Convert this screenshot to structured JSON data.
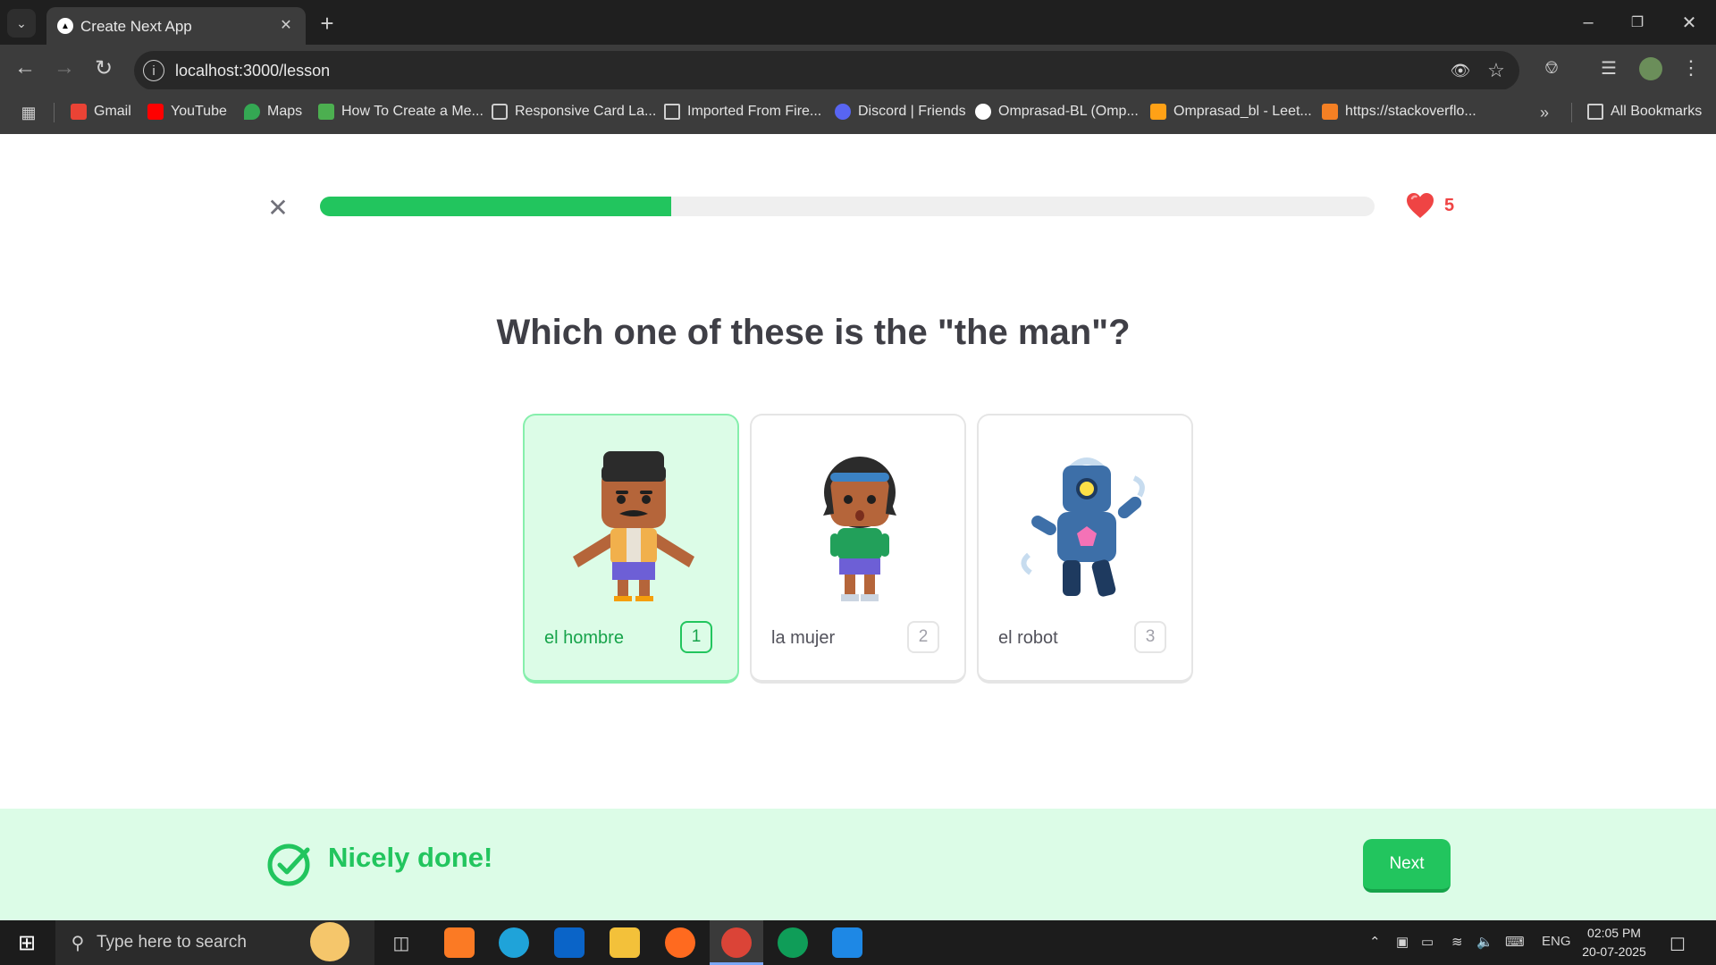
{
  "browser": {
    "tab_title": "Create Next App",
    "url": "localhost:3000/lesson",
    "bookmarks": [
      {
        "label": "Gmail",
        "icon": "gmail-icon",
        "color": "#ea4335"
      },
      {
        "label": "YouTube",
        "icon": "youtube-icon",
        "color": "#ff0000"
      },
      {
        "label": "Maps",
        "icon": "maps-icon",
        "color": "#34a853"
      },
      {
        "label": "How To Create a Me...",
        "icon": "w-logo-icon",
        "color": "#4caf50"
      },
      {
        "label": "Responsive Card La...",
        "icon": "page-icon",
        "color": "#cfcfcf"
      },
      {
        "label": "Imported From Fire...",
        "icon": "folder-icon",
        "color": "#cfcfcf"
      },
      {
        "label": "Discord | Friends",
        "icon": "discord-icon",
        "color": "#5865f2"
      },
      {
        "label": "Omprasad-BL (Omp...",
        "icon": "github-icon",
        "color": "#ffffff"
      },
      {
        "label": "Omprasad_bl - Leet...",
        "icon": "leetcode-icon",
        "color": "#ffa116"
      },
      {
        "label": "https://stackoverflo...",
        "icon": "stackoverflow-icon",
        "color": "#f48024"
      }
    ],
    "all_bookmarks": "All Bookmarks"
  },
  "lesson": {
    "progress_percent": 33.3,
    "hearts": "5",
    "question": "Which one of these is the \"the man\"?",
    "options": [
      {
        "label": "el hombre",
        "key": "1",
        "selected": true,
        "image": "man-character-icon"
      },
      {
        "label": "la mujer",
        "key": "2",
        "selected": false,
        "image": "woman-character-icon"
      },
      {
        "label": "el robot",
        "key": "3",
        "selected": false,
        "image": "robot-character-icon"
      }
    ],
    "status_text": "Nicely done!",
    "next_label": "Next"
  },
  "colors": {
    "accent": "#22c55e",
    "heart": "#ef4444",
    "footer_bg": "#dcfce7"
  },
  "taskbar": {
    "search_placeholder": "Type here to search",
    "language": "ENG",
    "time": "02:05 PM",
    "date": "20-07-2025"
  }
}
